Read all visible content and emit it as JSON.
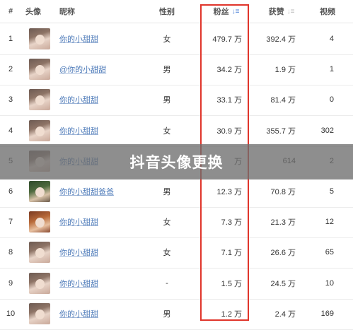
{
  "headers": {
    "rank": "#",
    "avatar": "头像",
    "nickname": "昵称",
    "gender": "性别",
    "fans": "粉丝",
    "likes": "获赞",
    "videos": "视频"
  },
  "rows": [
    {
      "rank": "1",
      "nickname": "你的小甜甜",
      "gender": "女",
      "fans": "479.7 万",
      "likes": "392.4 万",
      "videos": "4"
    },
    {
      "rank": "2",
      "nickname": "@你的小甜甜",
      "gender": "男",
      "fans": "34.2 万",
      "likes": "1.9 万",
      "videos": "1"
    },
    {
      "rank": "3",
      "nickname": "你的小甜甜",
      "gender": "男",
      "fans": "33.1 万",
      "likes": "81.4 万",
      "videos": "0"
    },
    {
      "rank": "4",
      "nickname": "你的小甜甜",
      "gender": "女",
      "fans": "30.9 万",
      "likes": "355.7 万",
      "videos": "302"
    },
    {
      "rank": "5",
      "nickname": "你的小甜甜",
      "gender": "",
      "fans": "万",
      "likes": "614",
      "videos": "2"
    },
    {
      "rank": "6",
      "nickname": "你的小甜甜爸爸",
      "gender": "男",
      "fans": "12.3 万",
      "likes": "70.8 万",
      "videos": "5"
    },
    {
      "rank": "7",
      "nickname": "你的小甜甜",
      "gender": "女",
      "fans": "7.3 万",
      "likes": "21.3 万",
      "videos": "12"
    },
    {
      "rank": "8",
      "nickname": "你的小甜甜",
      "gender": "女",
      "fans": "7.1 万",
      "likes": "26.6 万",
      "videos": "65"
    },
    {
      "rank": "9",
      "nickname": "你的小甜甜",
      "gender": "-",
      "fans": "1.5 万",
      "likes": "24.5 万",
      "videos": "10"
    },
    {
      "rank": "10",
      "nickname": "你的小甜甜",
      "gender": "男",
      "fans": "1.2 万",
      "likes": "2.4 万",
      "videos": "169"
    }
  ],
  "banner": "抖音头像更换",
  "colors": {
    "highlight_border": "#e0352b",
    "link": "#4a78b8",
    "sort_active": "#4a7fd6"
  },
  "icons": {
    "fans_sort": "sort-desc-icon",
    "likes_sort": "sort-icon"
  }
}
